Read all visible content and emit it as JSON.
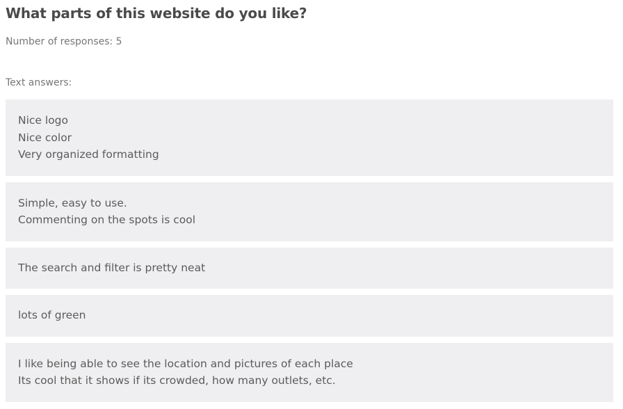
{
  "question": {
    "title": "What parts of this website do you like?",
    "responses_label": "Number of responses: 5",
    "answers_label": "Text answers:"
  },
  "answers": [
    {
      "lines": [
        "Nice logo",
        "Nice color",
        "Very organized formatting"
      ]
    },
    {
      "lines": [
        "Simple, easy to use.",
        "Commenting on the spots is cool"
      ]
    },
    {
      "lines": [
        "The search and filter is pretty neat"
      ]
    },
    {
      "lines": [
        "lots of green"
      ]
    },
    {
      "lines": [
        "I like being able to see the location and pictures of each place",
        "Its cool that it shows if its crowded, how many outlets, etc."
      ]
    }
  ],
  "colors": {
    "answer_background": "#efeff1",
    "title_text": "#4a4a4a",
    "muted_text": "#777777"
  }
}
